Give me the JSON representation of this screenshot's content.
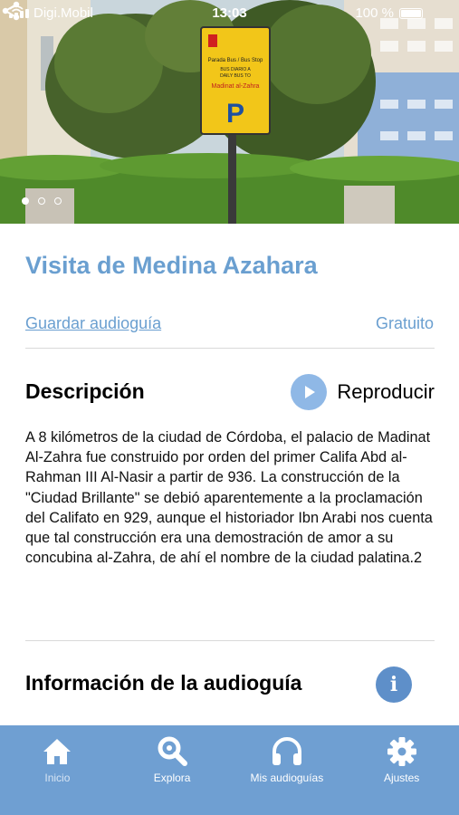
{
  "status_bar": {
    "carrier": "Digi.Mobil",
    "time": "13:03",
    "battery": "100 %"
  },
  "carousel": {
    "slides": 3,
    "active_index": 0
  },
  "hero_sign": {
    "line1": "Parada Bus / Bus Stop",
    "line2": "BUS DIARIO A",
    "line3": "DAILY BUS TO",
    "destination": "Madinat al-Zahra",
    "parking": "P"
  },
  "guide": {
    "title": "Visita de Medina Azahara",
    "save_label": "Guardar audioguía",
    "price": "Gratuito"
  },
  "description": {
    "heading": "Descripción",
    "play_label": "Reproducir",
    "text": "A 8 kilómetros de la ciudad de Córdoba, el palacio de Madinat Al-Zahra fue construido por orden del primer Califa Abd al-Rahman III Al-Nasir a partir de 936. La construcción de la \"Ciudad Brillante\" se debió aparentemente a la proclamación del Califato en 929, aunque el historiador Ibn Arabi nos cuenta que tal construcción era una demostración de amor a su concubina al-Zahra, de ahí el nombre de la ciudad palatina.2"
  },
  "info": {
    "heading": "Información de la audioguía",
    "icon_glyph": "i"
  },
  "tabbar": {
    "tabs": [
      {
        "label": "Inicio",
        "icon": "home-icon"
      },
      {
        "label": "Explora",
        "icon": "search-icon"
      },
      {
        "label": "Mis audioguías",
        "icon": "headphones-icon"
      },
      {
        "label": "Ajustes",
        "icon": "gear-icon"
      }
    ],
    "active_index": 3
  },
  "colors": {
    "accent": "#6a9fd0",
    "tabbar": "#6f9fd2",
    "play_button": "#8fb8e6",
    "info_button": "#5e8fc9"
  }
}
